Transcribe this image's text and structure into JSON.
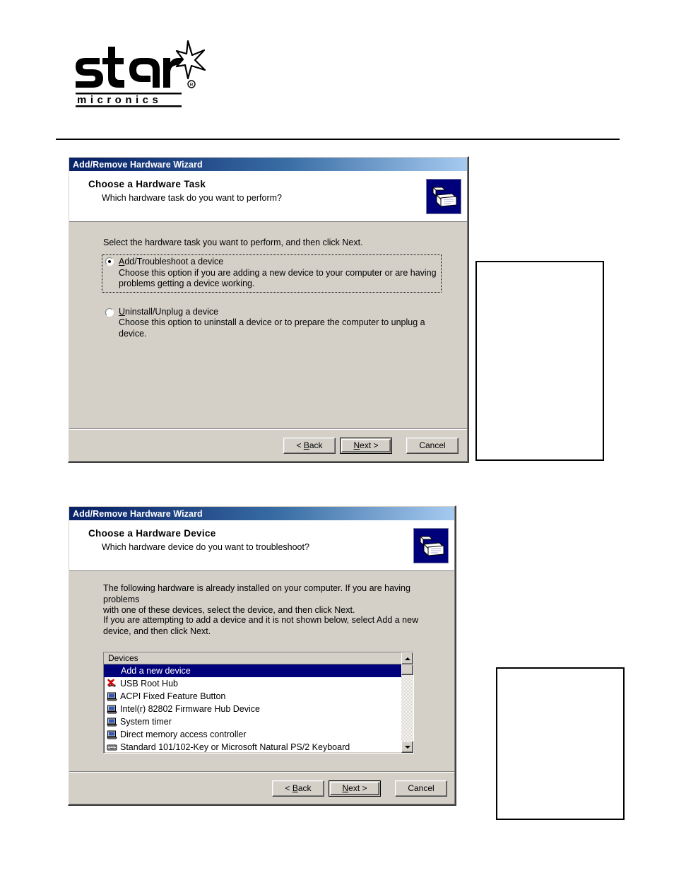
{
  "page": {
    "logo": {
      "wordmark": "star",
      "subtext": "micronics",
      "registered": "®"
    }
  },
  "dialog1": {
    "titlebar": "Add/Remove Hardware Wizard",
    "header_title": "Choose a Hardware Task",
    "header_subtitle": "Which hardware task do you want to perform?",
    "wizard_icon": "hardware-wizard-icon",
    "intro": "Select the hardware task you want to perform, and then click Next.",
    "options": [
      {
        "label": "Add/Troubleshoot a device",
        "description_line1": "Choose this option if you are adding a new device to your computer or are having",
        "description_line2": "problems getting a device working.",
        "selected": true,
        "focused": true
      },
      {
        "label": "Uninstall/Unplug a device",
        "description_line1": "Choose this option to uninstall a device or to prepare the computer to unplug a",
        "description_line2": "device.",
        "selected": false,
        "focused": false
      }
    ],
    "buttons": {
      "back": "< Back",
      "next": "Next >",
      "cancel": "Cancel",
      "default": "next"
    }
  },
  "dialog2": {
    "titlebar": "Add/Remove Hardware Wizard",
    "header_title": "Choose a Hardware Device",
    "header_subtitle": "Which hardware device do you want to troubleshoot?",
    "wizard_icon": "hardware-wizard-icon",
    "paragraph1_line1": "The following hardware is already installed on your computer. If you are having problems",
    "paragraph1_line2": "with one of these devices, select the device, and then click Next.",
    "paragraph2_line1": "If you are attempting to add a device and it is not shown below, select Add a new",
    "paragraph2_line2": "device, and then click Next.",
    "listbox": {
      "column_header": "Devices",
      "items": [
        {
          "label": "Add a new device",
          "icon": "none",
          "selected": true
        },
        {
          "label": "USB Root Hub",
          "icon": "usb-disabled-icon",
          "selected": false
        },
        {
          "label": "ACPI Fixed Feature Button",
          "icon": "computer-icon",
          "selected": false
        },
        {
          "label": "Intel(r) 82802 Firmware Hub Device",
          "icon": "computer-icon",
          "selected": false
        },
        {
          "label": "System timer",
          "icon": "computer-icon",
          "selected": false
        },
        {
          "label": "Direct memory access controller",
          "icon": "computer-icon",
          "selected": false
        },
        {
          "label": "Standard 101/102-Key or Microsoft Natural PS/2 Keyboard",
          "icon": "keyboard-icon",
          "selected": false
        }
      ]
    },
    "buttons": {
      "back": "< Back",
      "next": "Next >",
      "cancel": "Cancel",
      "default": "next"
    }
  },
  "callouts": [
    {
      "name": "callout-box-top",
      "text": ""
    },
    {
      "name": "callout-box-bottom",
      "text": ""
    }
  ],
  "colors": {
    "dialog_face": "#d4d0c8",
    "titlebar_start": "#0a246a",
    "titlebar_end": "#a6caf0",
    "selection": "#00007b",
    "icon_background": "#00007b"
  }
}
